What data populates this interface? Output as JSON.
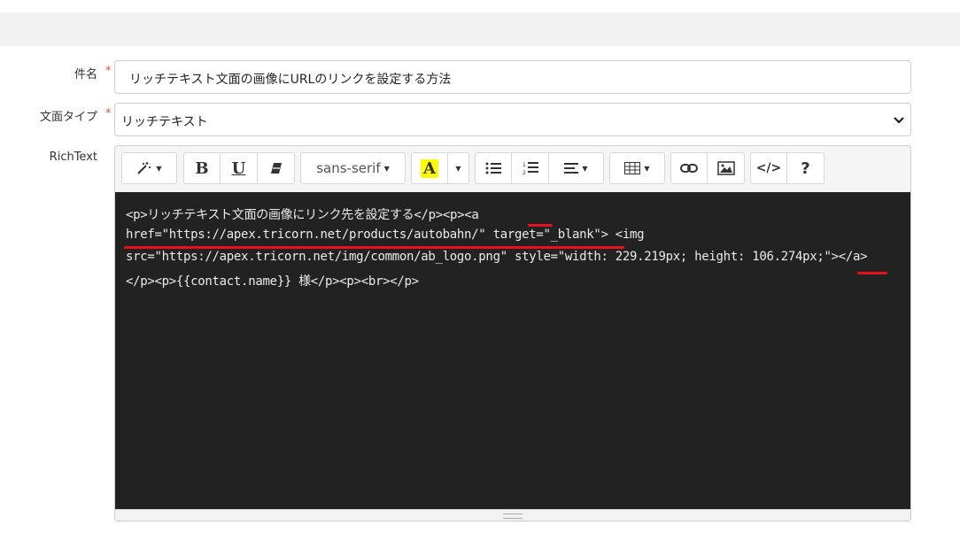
{
  "form": {
    "subject_label": "件名",
    "subject_value": "リッチテキスト文面の画像にURLのリンクを設定する方法",
    "type_label": "文面タイプ",
    "type_value": "リッチテキスト",
    "richtext_label": "RichText",
    "required_mark": "*"
  },
  "toolbar": {
    "bold": "B",
    "underline": "U",
    "font_name": "sans-serif",
    "font_color": "A",
    "codeview": "</>",
    "help": "?"
  },
  "code_lines": [
    "<p>リッチテキスト文面の画像にリンク先を設定する</p><p><a",
    "href=\"https://apex.tricorn.net/products/autobahn/\" target=\"_blank\"> <img",
    "src=\"https://apex.tricorn.net/img/common/ab_logo.png\" style=\"width: 229.219px; height: 106.274px;\"></a>",
    "</p><p>{{contact.name}} 様</p><p><br></p>"
  ],
  "colors": {
    "required": "#d9534f",
    "code_bg": "#222222",
    "underline": "#e8101c",
    "highlight": "#ffff00"
  }
}
